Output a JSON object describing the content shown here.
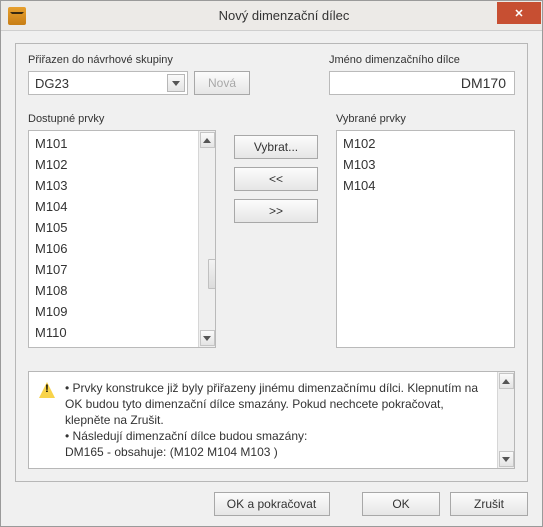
{
  "titlebar": {
    "title": "Nový dimenzační dílec"
  },
  "group": {
    "label": "Přiřazen do návrhové skupiny",
    "value": "DG23",
    "new_button": "Nová"
  },
  "name": {
    "label": "Jméno dimenzačního dílce",
    "value": "DM170"
  },
  "available": {
    "label": "Dostupné prvky",
    "items": [
      "M101",
      "M102",
      "M103",
      "M104",
      "M105",
      "M106",
      "M107",
      "M108",
      "M109",
      "M110"
    ]
  },
  "selected": {
    "label": "Vybrané prvky",
    "items": [
      "M102",
      "M103",
      "M104"
    ]
  },
  "transfer": {
    "select": "Vybrat...",
    "left": "<<",
    "right": ">>"
  },
  "warning": {
    "line1": "• Prvky konstrukce již byly přiřazeny jinému dimenzačnímu dílci. Klepnutím na OK budou tyto dimenzační dílce smazány. Pokud nechcete pokračovat, klepněte na Zrušit.",
    "line2": "• Následují dimenzační dílce budou smazány:",
    "line3": "DM165 - obsahuje: (M102 M104 M103 )"
  },
  "buttons": {
    "ok_continue": "OK a pokračovat",
    "ok": "OK",
    "cancel": "Zrušit"
  }
}
